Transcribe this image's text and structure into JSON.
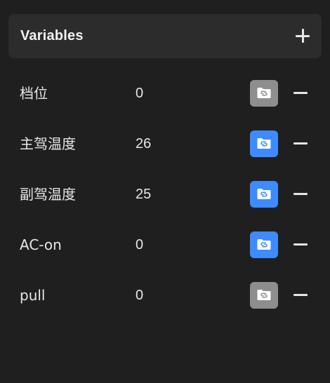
{
  "panel": {
    "title": "Variables",
    "add_icon": "plus-icon",
    "variables": [
      {
        "name": "档位",
        "value": "0",
        "bound": false
      },
      {
        "name": "主驾温度",
        "value": "26",
        "bound": true
      },
      {
        "name": "副驾温度",
        "value": "25",
        "bound": true
      },
      {
        "name": "AC-on",
        "value": "0",
        "bound": true
      },
      {
        "name": "pull",
        "value": "0",
        "bound": false
      }
    ],
    "bind_icon": "folder-link-icon",
    "remove_icon": "minus-icon"
  },
  "colors": {
    "background": "#1f1f1f",
    "header_background": "#2c2c2c",
    "bound_button": "#3d8bff",
    "unbound_button": "#8e8e8e",
    "text": "#e6e6e6"
  }
}
